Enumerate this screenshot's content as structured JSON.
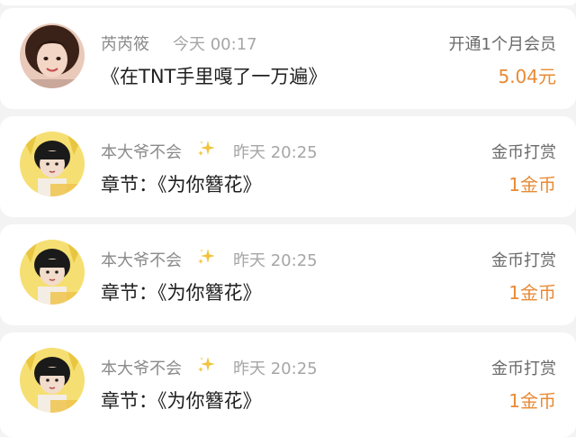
{
  "colors": {
    "amount": "#e88a34",
    "background": "#f3f3f3",
    "card": "#ffffff"
  },
  "records": [
    {
      "name": "芮芮筱",
      "time": "今天 00:17",
      "message": "《在TNT手里嘎了一万遍》",
      "type_label": "开通1个月会员",
      "amount": "5.04元",
      "avatar_icon": "user-photo-avatar",
      "has_sparkle": false
    },
    {
      "name": "本大爷不会",
      "time": "昨天 20:25",
      "message": "章节：《为你簪花》",
      "type_label": "金币打赏",
      "amount": "1金币",
      "avatar_icon": "user-photo-avatar",
      "has_sparkle": true
    },
    {
      "name": "本大爷不会",
      "time": "昨天 20:25",
      "message": "章节：《为你簪花》",
      "type_label": "金币打赏",
      "amount": "1金币",
      "avatar_icon": "user-photo-avatar",
      "has_sparkle": true
    },
    {
      "name": "本大爷不会",
      "time": "昨天 20:25",
      "message": "章节：《为你簪花》",
      "type_label": "金币打赏",
      "amount": "1金币",
      "avatar_icon": "user-photo-avatar",
      "has_sparkle": true
    }
  ]
}
